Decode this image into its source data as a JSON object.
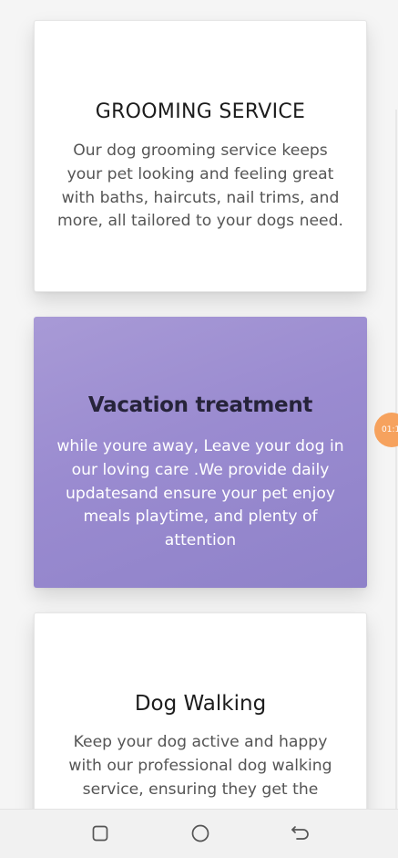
{
  "services": [
    {
      "title": "GROOMING SERVICE",
      "description": "Our dog grooming service keeps your pet looking and feeling great with baths, haircuts, nail trims, and more, all tailored to your dogs need."
    },
    {
      "title": "Vacation treatment",
      "description": "while youre away, Leave your dog in our loving care .We provide daily updatesand ensure your pet enjoy meals playtime, and plenty of attention"
    },
    {
      "title": "Dog Walking",
      "description": "Keep your dog active and happy with our professional dog walking service, ensuring they get the"
    }
  ],
  "floating_timer": {
    "text": "01:1"
  },
  "nav_bar": {
    "recents_icon": "square-recents-icon",
    "home_icon": "circle-home-icon",
    "back_icon": "back-arrow-icon"
  },
  "colors": {
    "highlight_card": "#9a8bd0",
    "timer_badge": "#f6a25e"
  }
}
